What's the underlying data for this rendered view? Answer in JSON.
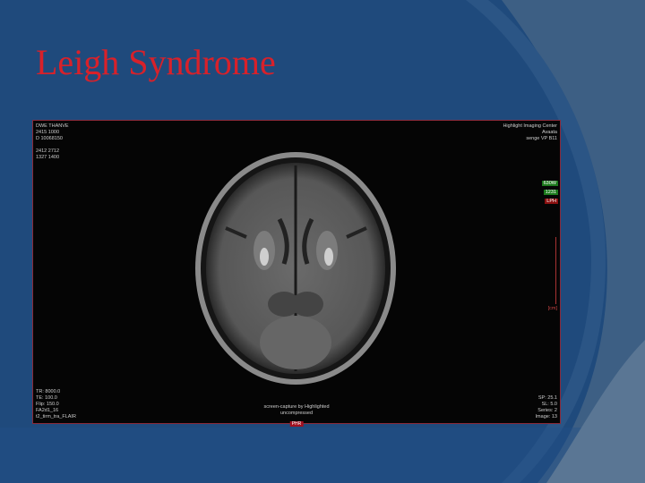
{
  "slide": {
    "title": "Leigh Syndrome"
  },
  "mri": {
    "top_left": "DWE THANVE\n2415 1000\nD 10068150\n\n2412 2712\n1327 1400",
    "top_right": "Highlight Imaging Center\nAvaata\nsenge VP B11",
    "tags": [
      {
        "label": "630W",
        "color": "#1d7a1d"
      },
      {
        "label": "1231",
        "color": "#1d7a1d"
      },
      {
        "label": "LPH",
        "color": "#8a1010"
      }
    ],
    "ruler_label": "[cm]",
    "bottom_left": "TR: 8000.0\nTE: 100.0\nFlip: 150.0\nFA2d1_16\nt2_tirm_tra_FLAIR",
    "bottom_center": "screen-capture by Highlighted\nuncompressed",
    "orientation": "PHR",
    "bottom_right": "SP: 25.1\nSL: 5.0\nSeries: 2\nImage: 13"
  }
}
